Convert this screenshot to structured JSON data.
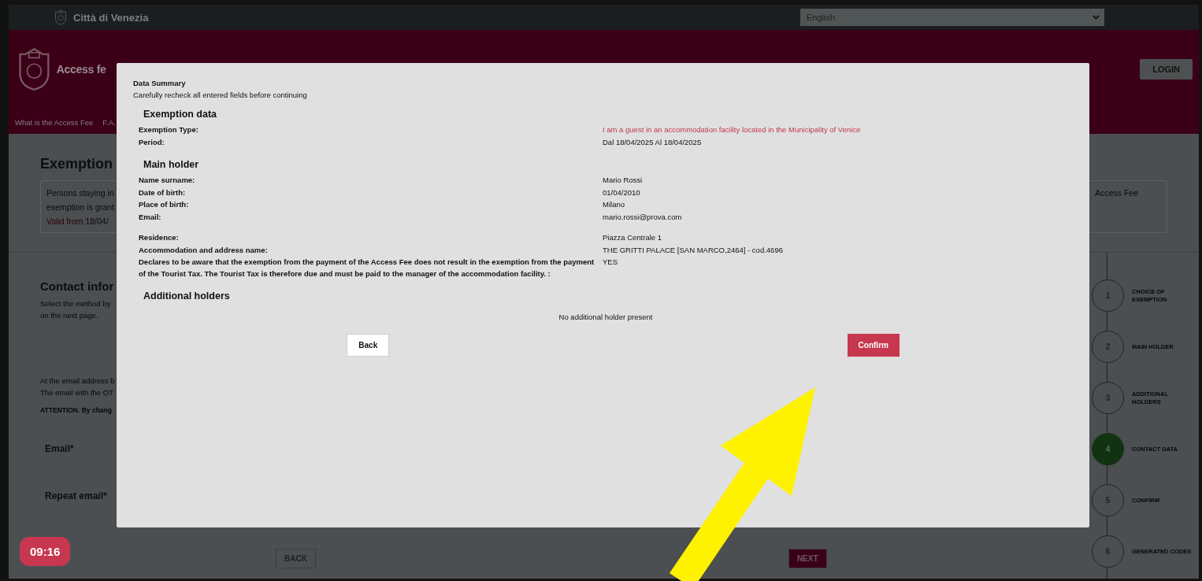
{
  "top_bar": {
    "site_name": "Città di Venezia",
    "language_select": {
      "value": "English"
    }
  },
  "header": {
    "title": "Access fe",
    "login_button": "LOGIN",
    "nav": [
      "What is the Access Fee",
      "F.A."
    ]
  },
  "exemption_section": {
    "title": "Exemption",
    "lines": [
      "Persons staying in",
      "exemption is grant"
    ],
    "valid_label": "Valid from",
    "valid_value": "18/04/",
    "right_text": "Access Fee"
  },
  "contact_section": {
    "title": "Contact infor",
    "intro": [
      "Select the method by",
      "on the next page."
    ],
    "notes": [
      "At the email address b",
      "The email with the OT"
    ],
    "attention": "ATTENTION. By chang",
    "fields": [
      "Email*",
      "Repeat email*"
    ],
    "back_button": "BACK",
    "next_button": "NEXT"
  },
  "timer": "09:16",
  "steps": [
    {
      "number": "1",
      "label": "CHOICE OF EXEMPTION",
      "selected": false
    },
    {
      "number": "2",
      "label": "MAIN HOLDER",
      "selected": false
    },
    {
      "number": "3",
      "label": "ADDITIONAL HOLDERS",
      "selected": false
    },
    {
      "number": "4",
      "label": "CONTACT DATA",
      "selected": true
    },
    {
      "number": "5",
      "label": "CONFIRM",
      "selected": false
    },
    {
      "number": "6",
      "label": "GENERATED CODES",
      "selected": false
    }
  ],
  "modal": {
    "title": "Data Summary",
    "subtitle": "Carefully recheck all entered fields before continuing",
    "sections": [
      {
        "heading": "Exemption data",
        "groups": [
          [
            {
              "label": "Exemption Type:",
              "value": "I am a guest in an accommodation facility located in the Municipality of Venice",
              "kind": "highlight"
            },
            {
              "label": "Period:",
              "value": "Dal 18/04/2025 Al 18/04/2025",
              "kind": "plain"
            }
          ]
        ]
      },
      {
        "heading": "Main holder",
        "groups": [
          [
            {
              "label": "Name surname:",
              "value": "Mario Rossi",
              "kind": "plain"
            },
            {
              "label": "Date of birth:",
              "value": "01/04/2010",
              "kind": "plain"
            },
            {
              "label": "Place of birth:",
              "value": "Milano",
              "kind": "plain"
            },
            {
              "label": "Email:",
              "value": "mario.rossi@prova.com",
              "kind": "plain"
            }
          ],
          [
            {
              "label": "Residence:",
              "value": "Piazza Centrale 1",
              "kind": "plain"
            },
            {
              "label": "Accommodation and address name:",
              "value": "THE GRITTI PALACE [SAN MARCO,2464] - cod.4696",
              "kind": "plain"
            },
            {
              "label": "Declares to be aware that the exemption from the payment of the Access Fee does not result in the exemption from the payment of the Tourist Tax. The Tourist Tax is therefore due and must be paid to the manager of the accommodation facility. :",
              "value": "YES",
              "kind": "plain"
            }
          ]
        ]
      },
      {
        "heading": "Additional holders",
        "empty_text": "No additional holder present"
      }
    ],
    "back_button": "Back",
    "confirm_button": "Confirm"
  }
}
